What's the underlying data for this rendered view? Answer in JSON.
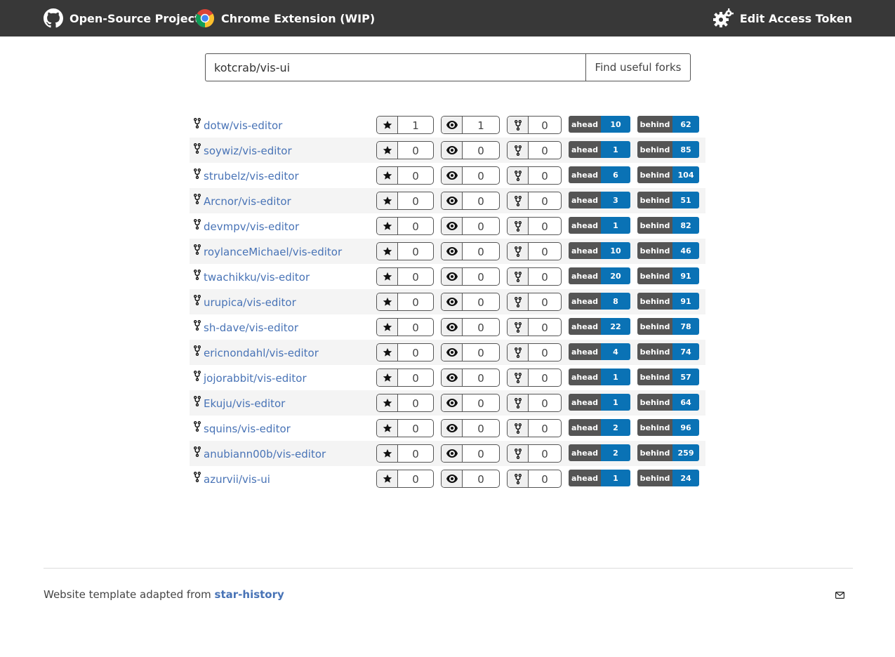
{
  "header": {
    "project_link": "Open-Source Project",
    "extension_link": "Chrome Extension (WIP)",
    "token_link": "Edit Access Token",
    "icons": {
      "project": "github-icon",
      "extension": "chrome-icon",
      "token": "gears-icon"
    }
  },
  "search": {
    "value": "kotcrab/vis-ui",
    "button_label": "Find useful forks"
  },
  "badge_labels": {
    "ahead": "ahead",
    "behind": "behind"
  },
  "forks": [
    {
      "name": "dotw/vis-editor",
      "stars": "1",
      "watchers": "1",
      "forks": "0",
      "ahead": "10",
      "behind": "62"
    },
    {
      "name": "soywiz/vis-editor",
      "stars": "0",
      "watchers": "0",
      "forks": "0",
      "ahead": "1",
      "behind": "85"
    },
    {
      "name": "strubelz/vis-editor",
      "stars": "0",
      "watchers": "0",
      "forks": "0",
      "ahead": "6",
      "behind": "104"
    },
    {
      "name": "Arcnor/vis-editor",
      "stars": "0",
      "watchers": "0",
      "forks": "0",
      "ahead": "3",
      "behind": "51"
    },
    {
      "name": "devmpv/vis-editor",
      "stars": "0",
      "watchers": "0",
      "forks": "0",
      "ahead": "1",
      "behind": "82"
    },
    {
      "name": "roylanceMichael/vis-editor",
      "stars": "0",
      "watchers": "0",
      "forks": "0",
      "ahead": "10",
      "behind": "46"
    },
    {
      "name": "twachikku/vis-editor",
      "stars": "0",
      "watchers": "0",
      "forks": "0",
      "ahead": "20",
      "behind": "91"
    },
    {
      "name": "urupica/vis-editor",
      "stars": "0",
      "watchers": "0",
      "forks": "0",
      "ahead": "8",
      "behind": "91"
    },
    {
      "name": "sh-dave/vis-editor",
      "stars": "0",
      "watchers": "0",
      "forks": "0",
      "ahead": "22",
      "behind": "78"
    },
    {
      "name": "ericnondahl/vis-editor",
      "stars": "0",
      "watchers": "0",
      "forks": "0",
      "ahead": "4",
      "behind": "74"
    },
    {
      "name": "jojorabbit/vis-editor",
      "stars": "0",
      "watchers": "0",
      "forks": "0",
      "ahead": "1",
      "behind": "57"
    },
    {
      "name": "Ekuju/vis-editor",
      "stars": "0",
      "watchers": "0",
      "forks": "0",
      "ahead": "1",
      "behind": "64"
    },
    {
      "name": "squins/vis-editor",
      "stars": "0",
      "watchers": "0",
      "forks": "0",
      "ahead": "2",
      "behind": "96"
    },
    {
      "name": "anubiann00b/vis-editor",
      "stars": "0",
      "watchers": "0",
      "forks": "0",
      "ahead": "2",
      "behind": "259"
    },
    {
      "name": "azurvii/vis-ui",
      "stars": "0",
      "watchers": "0",
      "forks": "0",
      "ahead": "1",
      "behind": "24"
    }
  ],
  "footer": {
    "text": "Website template adapted from ",
    "link": "star-history",
    "mail_icon": "mail-icon"
  },
  "colors": {
    "header_bg": "#383838",
    "link": "#4873b6",
    "badge_label": "#555555",
    "badge_value": "#0a72b5"
  }
}
